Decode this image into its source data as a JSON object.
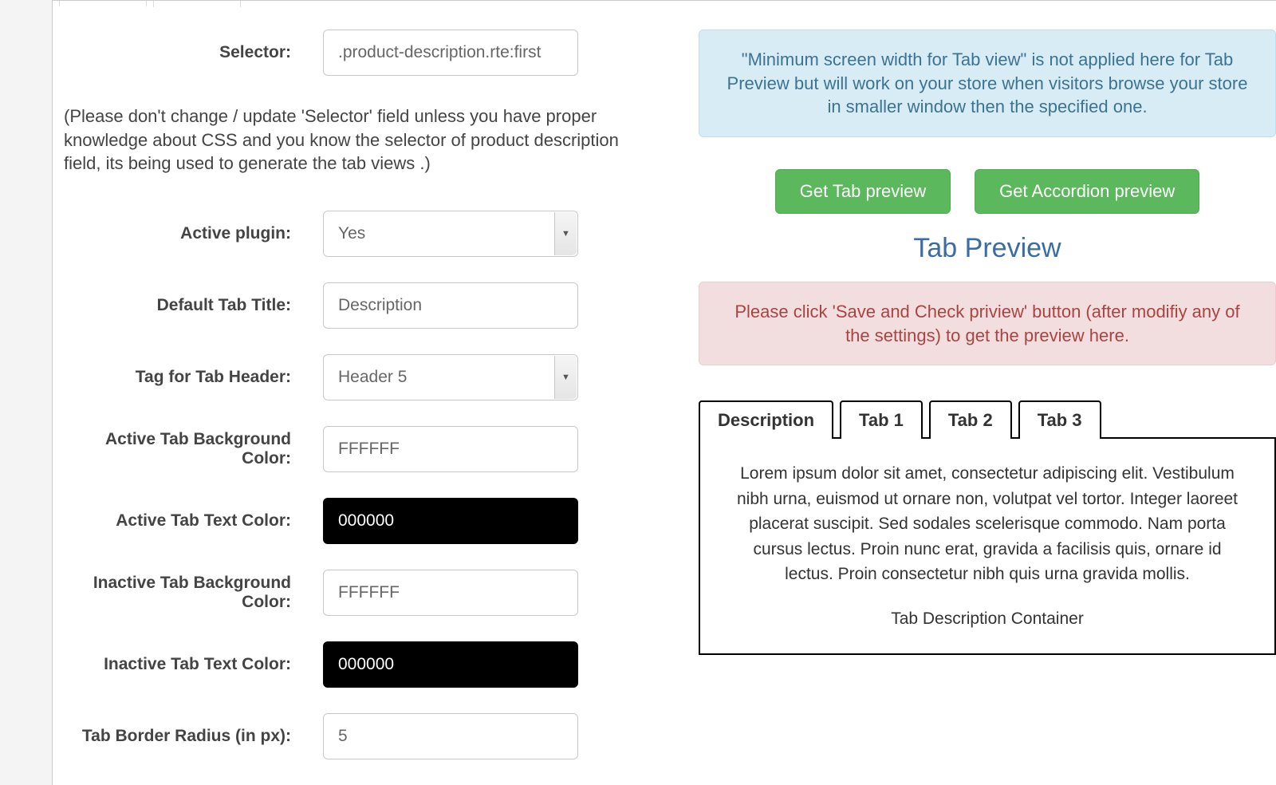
{
  "form": {
    "selector": {
      "label": "Selector:",
      "value": ".product-description.rte:first"
    },
    "selector_note": "(Please don't change / update 'Selector' field unless you have proper knowledge about CSS and you know the selector of product description field, its being used to generate the tab views .)",
    "active_plugin": {
      "label": "Active plugin:",
      "value": "Yes"
    },
    "default_tab_title": {
      "label": "Default Tab Title:",
      "value": "Description"
    },
    "tag_for_header": {
      "label": "Tag for Tab Header:",
      "value": "Header 5"
    },
    "active_bg": {
      "label": "Active Tab Background Color:",
      "value": "FFFFFF"
    },
    "active_text": {
      "label": "Active Tab Text Color:",
      "value": "000000"
    },
    "inactive_bg": {
      "label": "Inactive Tab Background Color:",
      "value": "FFFFFF"
    },
    "inactive_text": {
      "label": "Inactive Tab Text Color:",
      "value": "000000"
    },
    "border_radius": {
      "label": "Tab Border Radius (in px):",
      "value": "5"
    }
  },
  "right": {
    "info_alert": "\"Minimum screen width for Tab view\" is not applied here for Tab Preview but will work on your store when visitors browse your store in smaller window then the specified one.",
    "btn_tab": "Get Tab preview",
    "btn_accordion": "Get Accordion preview",
    "preview_title": "Tab Preview",
    "danger_alert": "Please click 'Save and Check priview' button (after modifiy any of the settings) to get the preview here.",
    "tabs": [
      "Description",
      "Tab 1",
      "Tab 2",
      "Tab 3"
    ],
    "tab_body": "Lorem ipsum dolor sit amet, consectetur adipiscing elit. Vestibulum nibh urna, euismod ut ornare non, volutpat vel tortor. Integer laoreet placerat suscipit. Sed sodales scelerisque commodo. Nam porta cursus lectus. Proin nunc erat, gravida a facilisis quis, ornare id lectus. Proin consectetur nibh quis urna gravida mollis.",
    "tab_container_label": "Tab Description Container"
  }
}
